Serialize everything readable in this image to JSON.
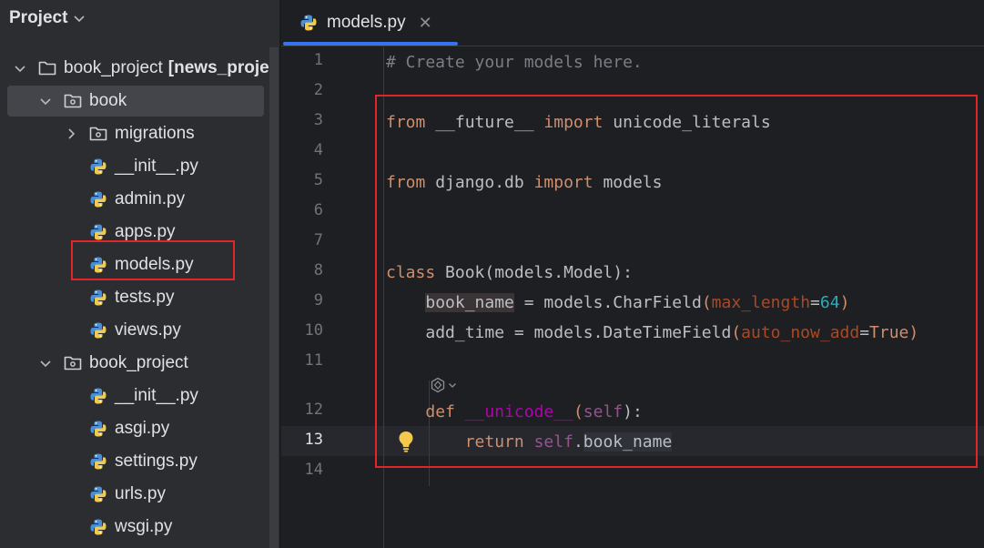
{
  "project_panel": {
    "title": "Project",
    "tree": [
      {
        "label": "book_project",
        "bold_suffix": "[news_proje",
        "type": "folder",
        "expanded": true
      },
      {
        "label": "book",
        "type": "package",
        "expanded": true,
        "selected": true
      },
      {
        "label": "migrations",
        "type": "package",
        "expanded": false
      },
      {
        "label": "__init__.py",
        "type": "python"
      },
      {
        "label": "admin.py",
        "type": "python"
      },
      {
        "label": "apps.py",
        "type": "python"
      },
      {
        "label": "models.py",
        "type": "python",
        "highlighted": true
      },
      {
        "label": "tests.py",
        "type": "python"
      },
      {
        "label": "views.py",
        "type": "python"
      },
      {
        "label": "book_project",
        "type": "package",
        "expanded": true
      },
      {
        "label": "__init__.py",
        "type": "python"
      },
      {
        "label": "asgi.py",
        "type": "python"
      },
      {
        "label": "settings.py",
        "type": "python"
      },
      {
        "label": "urls.py",
        "type": "python"
      },
      {
        "label": "wsgi.py",
        "type": "python"
      }
    ]
  },
  "editor": {
    "tab": {
      "label": "models.py",
      "close": "✕"
    },
    "line_numbers": [
      "1",
      "2",
      "3",
      "4",
      "5",
      "6",
      "7",
      "8",
      "9",
      "10",
      "11",
      "12",
      "13",
      "14"
    ],
    "current_line": "13",
    "code": {
      "l1": "# Create your models here.",
      "l3_kw1": "from",
      "l3_mod": " __future__ ",
      "l3_kw2": "import",
      "l3_name": " unicode_literals",
      "l5_kw1": "from",
      "l5_mod": " django.db ",
      "l5_kw2": "import",
      "l5_name": " models",
      "l8_kw": "class",
      "l8_rest": " Book(models.Model):",
      "l9_indent": "    ",
      "l9_var": "book_name",
      "l9_mid": " = models.CharField",
      "l9_paren_open": "(",
      "l9_param": "max_length",
      "l9_eq": "=",
      "l9_num": "64",
      "l9_paren_close": ")",
      "l10_indent": "    ",
      "l10_var": "add_time = models.DateTimeField",
      "l10_paren_open": "(",
      "l10_param": "auto_now_add",
      "l10_eq": "=",
      "l10_kw": "True",
      "l10_paren_close": ")",
      "l12_indent": "    ",
      "l12_kw": "def",
      "l12_sp": " ",
      "l12_fn": "__unicode__",
      "l12_paren_open": "(",
      "l12_self": "self",
      "l12_close": "):",
      "l13_indent": "        ",
      "l13_kw": "return",
      "l13_sp": " ",
      "l13_self": "self",
      "l13_dot": ".",
      "l13_attr": "book_name"
    }
  },
  "icons": {
    "chevron": "chevron-down-icon",
    "folder": "folder-icon",
    "package": "package-folder-icon",
    "python": "python-file-icon",
    "bulb": "lightbulb-icon",
    "ai_inlay": "ai-assistant-icon"
  },
  "colors": {
    "annotation_box": "#e0262b",
    "tab_underline": "#3574f0",
    "keyword": "#cf8e6d",
    "dunder": "#b200b2",
    "param": "#aa4926",
    "number": "#2aacb8"
  }
}
